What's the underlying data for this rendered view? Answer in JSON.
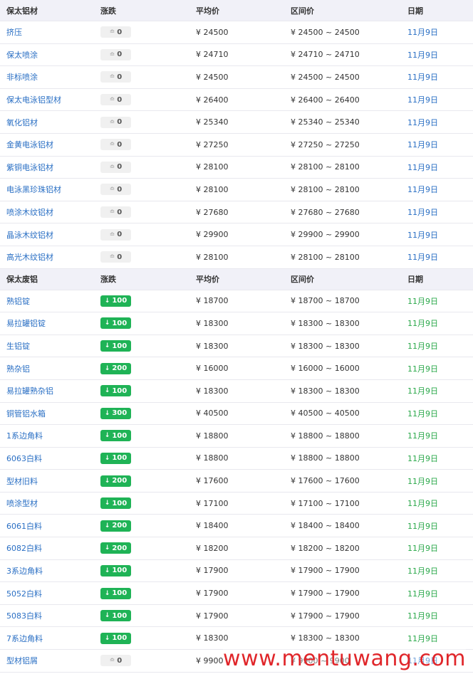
{
  "section1": {
    "header": {
      "name": "保太铝材",
      "change": "涨跌",
      "avg": "平均价",
      "range": "区间价",
      "date": "日期"
    },
    "rows": [
      {
        "name": "挤压",
        "change": "0",
        "avg": "¥ 24500",
        "range": "¥ 24500 ~ 24500",
        "date": "11月9日"
      },
      {
        "name": "保太喷涂",
        "change": "0",
        "avg": "¥ 24710",
        "range": "¥ 24710 ~ 24710",
        "date": "11月9日"
      },
      {
        "name": "非标喷涂",
        "change": "0",
        "avg": "¥ 24500",
        "range": "¥ 24500 ~ 24500",
        "date": "11月9日"
      },
      {
        "name": "保太电泳铝型材",
        "change": "0",
        "avg": "¥ 26400",
        "range": "¥ 26400 ~ 26400",
        "date": "11月9日"
      },
      {
        "name": "氧化铝材",
        "change": "0",
        "avg": "¥ 25340",
        "range": "¥ 25340 ~ 25340",
        "date": "11月9日"
      },
      {
        "name": "金黄电泳铝材",
        "change": "0",
        "avg": "¥ 27250",
        "range": "¥ 27250 ~ 27250",
        "date": "11月9日"
      },
      {
        "name": "紫铜电泳铝材",
        "change": "0",
        "avg": "¥ 28100",
        "range": "¥ 28100 ~ 28100",
        "date": "11月9日"
      },
      {
        "name": "电泳黑珍珠铝材",
        "change": "0",
        "avg": "¥ 28100",
        "range": "¥ 28100 ~ 28100",
        "date": "11月9日"
      },
      {
        "name": "喷涂木纹铝材",
        "change": "0",
        "avg": "¥ 27680",
        "range": "¥ 27680 ~ 27680",
        "date": "11月9日"
      },
      {
        "name": "晶泳木纹铝材",
        "change": "0",
        "avg": "¥ 29900",
        "range": "¥ 29900 ~ 29900",
        "date": "11月9日"
      },
      {
        "name": "高光木纹铝材",
        "change": "0",
        "avg": "¥ 28100",
        "range": "¥ 28100 ~ 28100",
        "date": "11月9日"
      }
    ]
  },
  "section2": {
    "header": {
      "name": "保太废铝",
      "change": "涨跌",
      "avg": "平均价",
      "range": "区间价",
      "date": "日期"
    },
    "rows": [
      {
        "name": "熟铝锭",
        "change": "100",
        "avg": "¥ 18700",
        "range": "¥ 18700 ~ 18700",
        "date": "11月9日"
      },
      {
        "name": "易拉罐铝锭",
        "change": "100",
        "avg": "¥ 18300",
        "range": "¥ 18300 ~ 18300",
        "date": "11月9日"
      },
      {
        "name": "生铝锭",
        "change": "100",
        "avg": "¥ 18300",
        "range": "¥ 18300 ~ 18300",
        "date": "11月9日"
      },
      {
        "name": "熟杂铝",
        "change": "200",
        "avg": "¥ 16000",
        "range": "¥ 16000 ~ 16000",
        "date": "11月9日"
      },
      {
        "name": "易拉罐熟杂铝",
        "change": "100",
        "avg": "¥ 18300",
        "range": "¥ 18300 ~ 18300",
        "date": "11月9日"
      },
      {
        "name": "铜管铝水箱",
        "change": "300",
        "avg": "¥ 40500",
        "range": "¥ 40500 ~ 40500",
        "date": "11月9日"
      },
      {
        "name": "1系边角料",
        "change": "100",
        "avg": "¥ 18800",
        "range": "¥ 18800 ~ 18800",
        "date": "11月9日"
      },
      {
        "name": "6063白料",
        "change": "100",
        "avg": "¥ 18800",
        "range": "¥ 18800 ~ 18800",
        "date": "11月9日"
      },
      {
        "name": "型材旧料",
        "change": "200",
        "avg": "¥ 17600",
        "range": "¥ 17600 ~ 17600",
        "date": "11月9日"
      },
      {
        "name": "喷涂型材",
        "change": "100",
        "avg": "¥ 17100",
        "range": "¥ 17100 ~ 17100",
        "date": "11月9日"
      },
      {
        "name": "6061白料",
        "change": "200",
        "avg": "¥ 18400",
        "range": "¥ 18400 ~ 18400",
        "date": "11月9日"
      },
      {
        "name": "6082白料",
        "change": "200",
        "avg": "¥ 18200",
        "range": "¥ 18200 ~ 18200",
        "date": "11月9日"
      },
      {
        "name": "3系边角料",
        "change": "100",
        "avg": "¥ 17900",
        "range": "¥ 17900 ~ 17900",
        "date": "11月9日"
      },
      {
        "name": "5052白料",
        "change": "100",
        "avg": "¥ 17900",
        "range": "¥ 17900 ~ 17900",
        "date": "11月9日"
      },
      {
        "name": "5083白料",
        "change": "100",
        "avg": "¥ 17900",
        "range": "¥ 17900 ~ 17900",
        "date": "11月9日"
      },
      {
        "name": "7系边角料",
        "change": "100",
        "avg": "¥ 18300",
        "range": "¥ 18300 ~ 18300",
        "date": "11月9日"
      },
      {
        "name": "型材铝屑",
        "change": "0",
        "avg": "¥ 9900",
        "range": "¥ 9900 ~ 9900",
        "date": "11月9日"
      }
    ]
  },
  "icons": {
    "flat": "flat-change-icon",
    "down": "down-arrow-icon"
  },
  "colors": {
    "link": "#2a6fc4",
    "down_badge": "#1fb356",
    "date_green": "#2aa84a",
    "header_bg": "#f1f1f8"
  },
  "watermark": "www.mentuwang.com"
}
